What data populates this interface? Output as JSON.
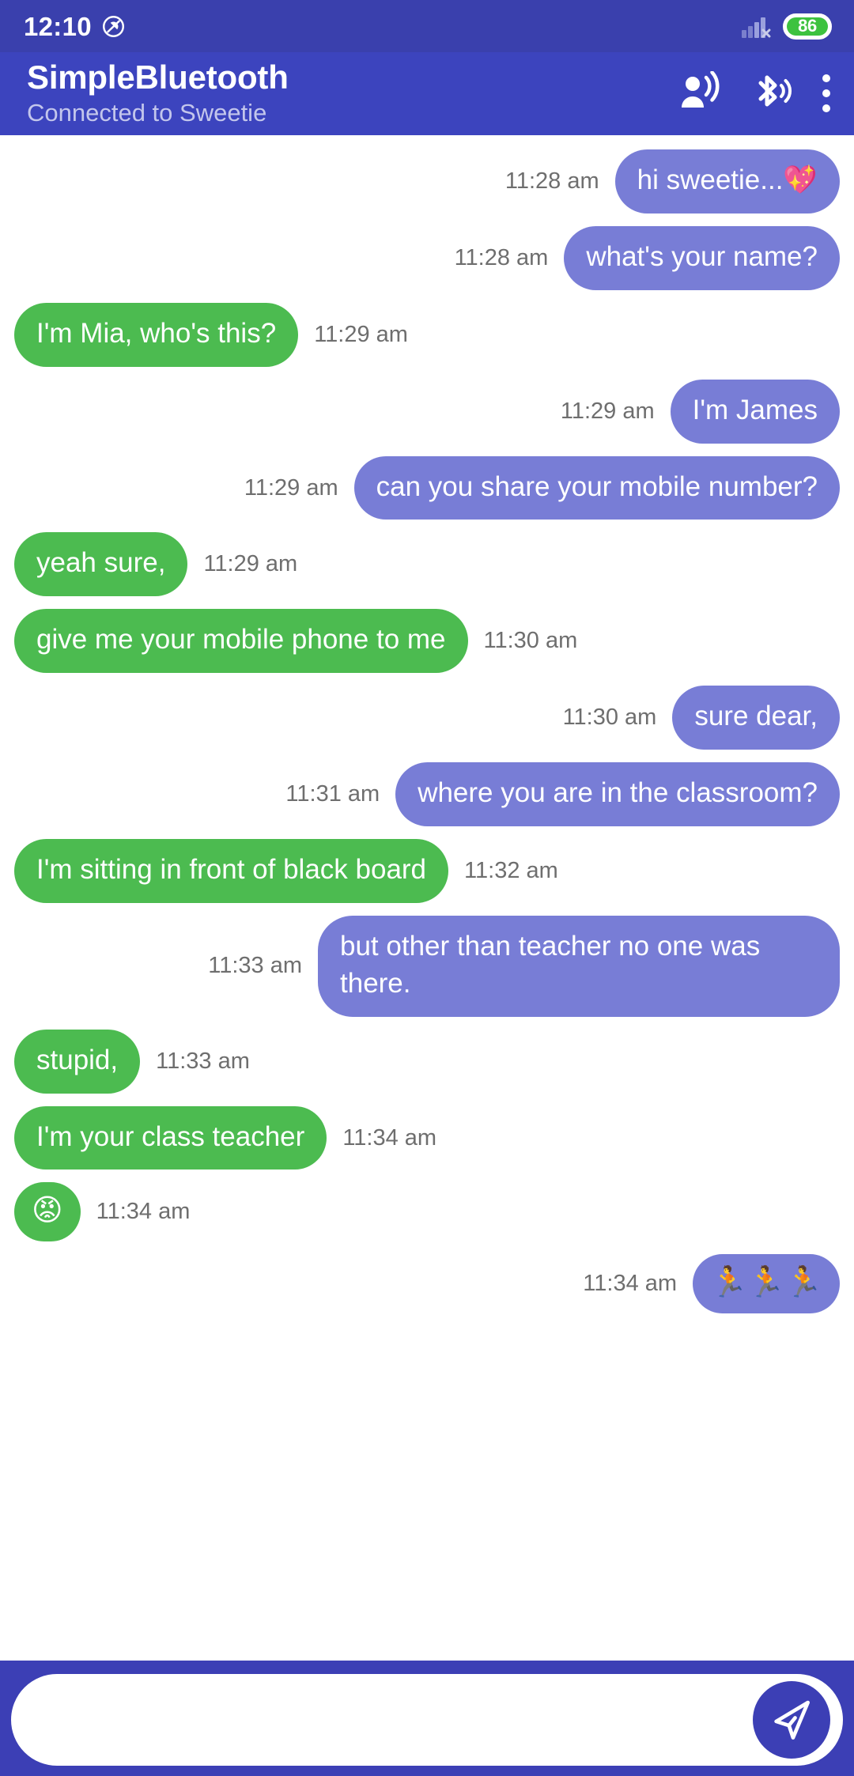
{
  "status_bar": {
    "clock": "12:10",
    "dnd_icon": "do-not-disturb-icon",
    "signal_icon": "signal-no-service-icon",
    "battery_level": "86",
    "battery_color": "#3dc23f"
  },
  "app_bar": {
    "title": "SimpleBluetooth",
    "subtitle": "Connected to Sweetie",
    "actions": [
      {
        "name": "voice-broadcast-icon",
        "label": "Voice broadcast"
      },
      {
        "name": "bluetooth-audio-icon",
        "label": "Bluetooth audio"
      },
      {
        "name": "overflow-menu-icon",
        "label": "More options"
      }
    ],
    "background_color": "#3c44be"
  },
  "theme": {
    "outgoing_bubble_color": "#787dd6",
    "incoming_bubble_color": "#4cbb50",
    "timestamp_color": "#6e6e6e",
    "accent_color": "#3c3fb5"
  },
  "messages": [
    {
      "direction": "out",
      "text": "hi sweetie...💖",
      "time": "11:28 am"
    },
    {
      "direction": "out",
      "text": "what's your name?",
      "time": "11:28 am"
    },
    {
      "direction": "in",
      "text": "I'm Mia, who's this?",
      "time": "11:29 am"
    },
    {
      "direction": "out",
      "text": "I'm James",
      "time": "11:29 am"
    },
    {
      "direction": "out",
      "text": "can you share your mobile number?",
      "time": "11:29 am"
    },
    {
      "direction": "in",
      "text": "yeah sure,",
      "time": "11:29 am"
    },
    {
      "direction": "in",
      "text": "give me your mobile phone to me",
      "time": "11:30 am"
    },
    {
      "direction": "out",
      "text": "sure dear,",
      "time": "11:30 am"
    },
    {
      "direction": "out",
      "text": "where you are in the classroom?",
      "time": "11:31 am"
    },
    {
      "direction": "in",
      "text": "I'm sitting in front of black board",
      "time": "11:32 am"
    },
    {
      "direction": "out",
      "text": "but other than teacher no one was there.",
      "time": "11:33 am"
    },
    {
      "direction": "in",
      "text": "stupid,",
      "time": "11:33 am"
    },
    {
      "direction": "in",
      "text": "I'm your class teacher",
      "time": "11:34 am"
    },
    {
      "direction": "in",
      "text": "😡",
      "time": "11:34 am",
      "emoji_only": true
    },
    {
      "direction": "out",
      "text": "🏃🏃🏃",
      "time": "11:34 am",
      "emoji_only": true
    }
  ],
  "input_bar": {
    "value": "",
    "placeholder": "",
    "send_icon": "send-icon"
  }
}
